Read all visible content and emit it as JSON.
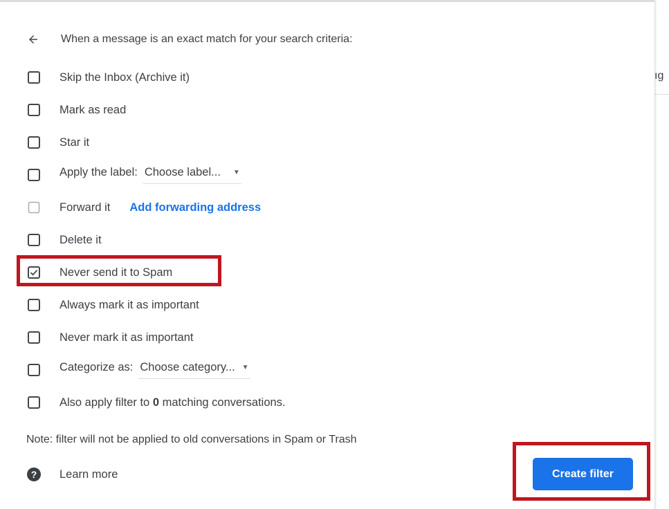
{
  "background_hint": {
    "truncated_text": "ıg"
  },
  "header": {
    "text": "When a message is an exact match for your search criteria:"
  },
  "options": [
    {
      "label": "Skip the Inbox (Archive it)",
      "checked": false
    },
    {
      "label": "Mark as read",
      "checked": false
    },
    {
      "label": "Star it",
      "checked": false
    },
    {
      "label": "Apply the label:",
      "checked": false,
      "dropdown": "Choose label..."
    },
    {
      "label": "Forward it",
      "checked": false,
      "disabled": true,
      "link": "Add forwarding address"
    },
    {
      "label": "Delete it",
      "checked": false
    },
    {
      "label": "Never send it to Spam",
      "checked": true
    },
    {
      "label": "Always mark it as important",
      "checked": false
    },
    {
      "label": "Never mark it as important",
      "checked": false
    },
    {
      "label": "Categorize as:",
      "checked": false,
      "dropdown": "Choose category..."
    },
    {
      "label_prefix": "Also apply filter to",
      "count": "0",
      "label_suffix": "matching conversations.",
      "checked": false
    }
  ],
  "note": "Note: filter will not be applied to old conversations in Spam or Trash",
  "learn_more": "Learn more",
  "create_filter": "Create filter",
  "colors": {
    "accent": "#1a73e8",
    "highlight": "#c0161e"
  },
  "icons": {
    "back": "arrow-left-icon",
    "help": "help-circle-icon",
    "checkbox": "checkbox-icon",
    "dropdown": "caret-down-icon"
  }
}
